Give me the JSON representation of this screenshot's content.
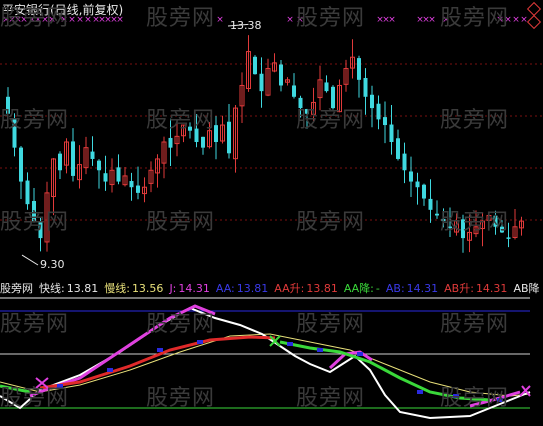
{
  "title": "平安银行(日线,前复权)",
  "watermark": "股旁网",
  "price_high_label": "13.38",
  "price_low_label": "9.30",
  "indicator": {
    "name": "股旁网",
    "fast_label": "快线:",
    "fast_value": "13.81",
    "slow_label": "慢线:",
    "slow_value": "13.56",
    "j_label": "J:",
    "j_value": "14.31",
    "aa_label": "AA:",
    "aa_value": "13.81",
    "aa_up_label": "AA升:",
    "aa_up_value": "13.81",
    "aa_down_label": "AA降:",
    "aa_down_value": "-",
    "ab_label": "AB:",
    "ab_value": "14.31",
    "ab_up_label": "AB升:",
    "ab_up_value": "14.31",
    "ab_more": "AB降"
  },
  "colors": {
    "up": "#e03a3a",
    "down": "#3fd9e0",
    "magenta": "#e040e0",
    "white": "#ffffff",
    "yellow": "#e8e07a",
    "green": "#3ad83a",
    "blue": "#2a2ae0",
    "red": "#e02a2a"
  },
  "chart_data": {
    "type": "candlestick",
    "ylim": [
      9.0,
      13.6
    ],
    "max_price": 13.38,
    "min_price": 9.3,
    "closes": [
      11.8,
      11.2,
      10.6,
      10.2,
      9.9,
      9.6,
      10.4,
      11.0,
      10.8,
      11.3,
      10.7,
      10.9,
      11.2,
      11.0,
      10.8,
      10.6,
      10.8,
      10.6,
      10.7,
      10.5,
      10.4,
      10.5,
      10.8,
      11.0,
      11.3,
      11.2,
      11.4,
      11.6,
      11.5,
      11.3,
      11.2,
      11.5,
      11.3,
      11.6,
      11.1,
      11.9,
      12.3,
      12.9,
      12.5,
      12.2,
      12.6,
      12.7,
      12.3,
      12.4,
      12.1,
      11.9,
      11.8,
      12.0,
      12.4,
      12.2,
      11.9,
      12.3,
      12.6,
      12.8,
      12.4,
      12.1,
      11.9,
      11.7,
      11.6,
      11.3,
      11.0,
      10.8,
      10.6,
      10.5,
      10.3,
      10.1,
      10.0,
      9.9,
      9.8,
      9.9,
      9.6,
      9.7,
      9.8,
      9.9,
      10.0,
      9.8,
      9.7,
      9.6,
      9.8,
      9.9
    ]
  }
}
